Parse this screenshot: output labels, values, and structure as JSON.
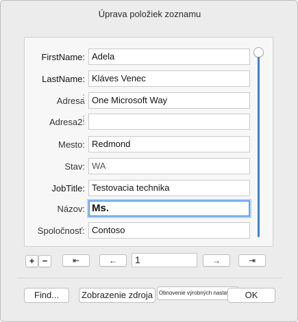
{
  "dialog": {
    "title": "Úprava položiek zoznamu"
  },
  "fields": [
    {
      "label": "FirstName:",
      "value": "Adela"
    },
    {
      "label": "LastName:",
      "value": "Kláves Venec"
    },
    {
      "label": "Adresa",
      "value": "One Microsoft Way"
    },
    {
      "label": "Adresa2:",
      "value": ""
    },
    {
      "label": "Mesto:",
      "value": "Redmond"
    },
    {
      "label": "Stav:",
      "value": "WA"
    },
    {
      "label": "JobTitle:",
      "value": "Testovacia technika"
    },
    {
      "label": "Názov:",
      "value": "Ms."
    },
    {
      "label": "Spoločnosť:",
      "value": "Contoso"
    }
  ],
  "record_nav": {
    "add": "+",
    "remove": "−",
    "first": "⇤",
    "prev": "←",
    "current": "1",
    "next": "→",
    "last": "⇥"
  },
  "buttons": {
    "find": "Find...",
    "source": "Zobrazenie zdroja",
    "restore": "Obnovenie výrobných nastavení",
    "ok": "OK"
  },
  "colors": {
    "accent": "#3d80e0",
    "focus_ring": "#6aa0e6"
  }
}
